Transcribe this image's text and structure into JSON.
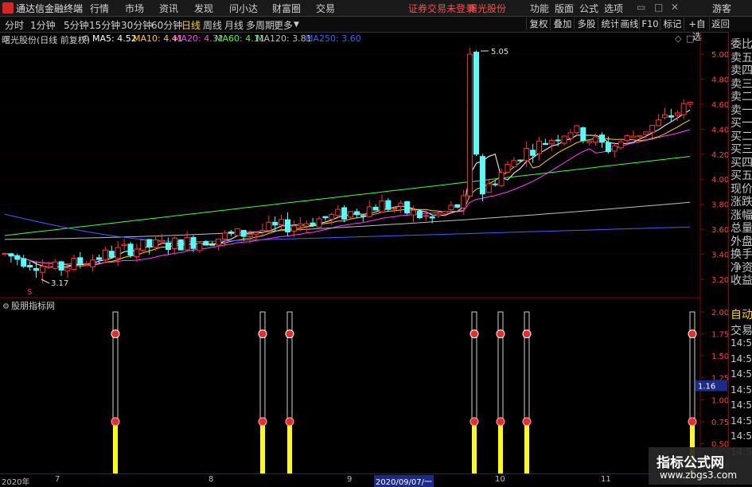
{
  "app": {
    "title": "通达信金融终端"
  },
  "menu": [
    "行情",
    "市场",
    "资讯",
    "发现",
    "问小达",
    "财富圈",
    "交易"
  ],
  "status_notice": "证券交易未登录",
  "stock_name_top": "曙光股份",
  "right_menu": [
    "功能",
    "版面",
    "公式",
    "选项"
  ],
  "guest": "游客",
  "periods": [
    "分时",
    "1分钟",
    "5分钟",
    "15分钟",
    "30分钟",
    "60分钟",
    "日线",
    "周线",
    "月线",
    "多周期",
    "更多"
  ],
  "active_period": "日线",
  "right_buttons": [
    "复权",
    "叠加",
    "多股",
    "统计",
    "画线",
    "F10",
    "标记",
    "+自选",
    "返回"
  ],
  "chart_header": "曙光股份(日线 前复权)",
  "ma": [
    {
      "label": "MA5: 4.52",
      "color": "#ffffff"
    },
    {
      "label": "MA10: 4.41",
      "color": "#ffd400"
    },
    {
      "label": "MA20: 4.32",
      "color": "#ff40ff"
    },
    {
      "label": "MA60: 4.11",
      "color": "#40ff40"
    },
    {
      "label": "MA120: 3.81",
      "color": "#c0c0c0"
    },
    {
      "label": "MA250: 3.60",
      "color": "#4060ff"
    }
  ],
  "price_axis": [
    "5.00",
    "4.80",
    "4.60",
    "4.40",
    "4.20",
    "4.00",
    "3.80",
    "3.60",
    "3.40",
    "3.20"
  ],
  "annotations": {
    "high": "5.05",
    "low": "3.17",
    "marker": "S"
  },
  "indicator_title": "股朋指标网",
  "indicator_axis": [
    "2.00",
    "1.75",
    "1.50",
    "1.25",
    "1.00",
    "0.75",
    "0.50",
    "0.25"
  ],
  "indicator_value": "1.16",
  "right_panel": [
    "委比",
    "卖五",
    "卖四",
    "卖三",
    "卖二",
    "卖一",
    "买一",
    "买二",
    "买三",
    "买四",
    "买五",
    "现价",
    "涨跌",
    "涨幅",
    "总量",
    "外盘",
    "换手",
    "净资",
    "收益"
  ],
  "right_panel_lower": [
    "自动",
    "交易",
    "14:56",
    "14:56",
    "14:56",
    "14:56",
    "14:56",
    "14:56",
    "14:56",
    "14:56"
  ],
  "date_axis": [
    "2020年",
    "7",
    "8",
    "9",
    "2020/09/07/一",
    "10",
    "11"
  ],
  "watermark": {
    "line1": "指标公式网",
    "line2": "www.zbgs3.com"
  },
  "colors": {
    "up": "#ff3232",
    "down": "#54ffff",
    "signal": "#ffff00",
    "border": "#8b0000"
  }
}
